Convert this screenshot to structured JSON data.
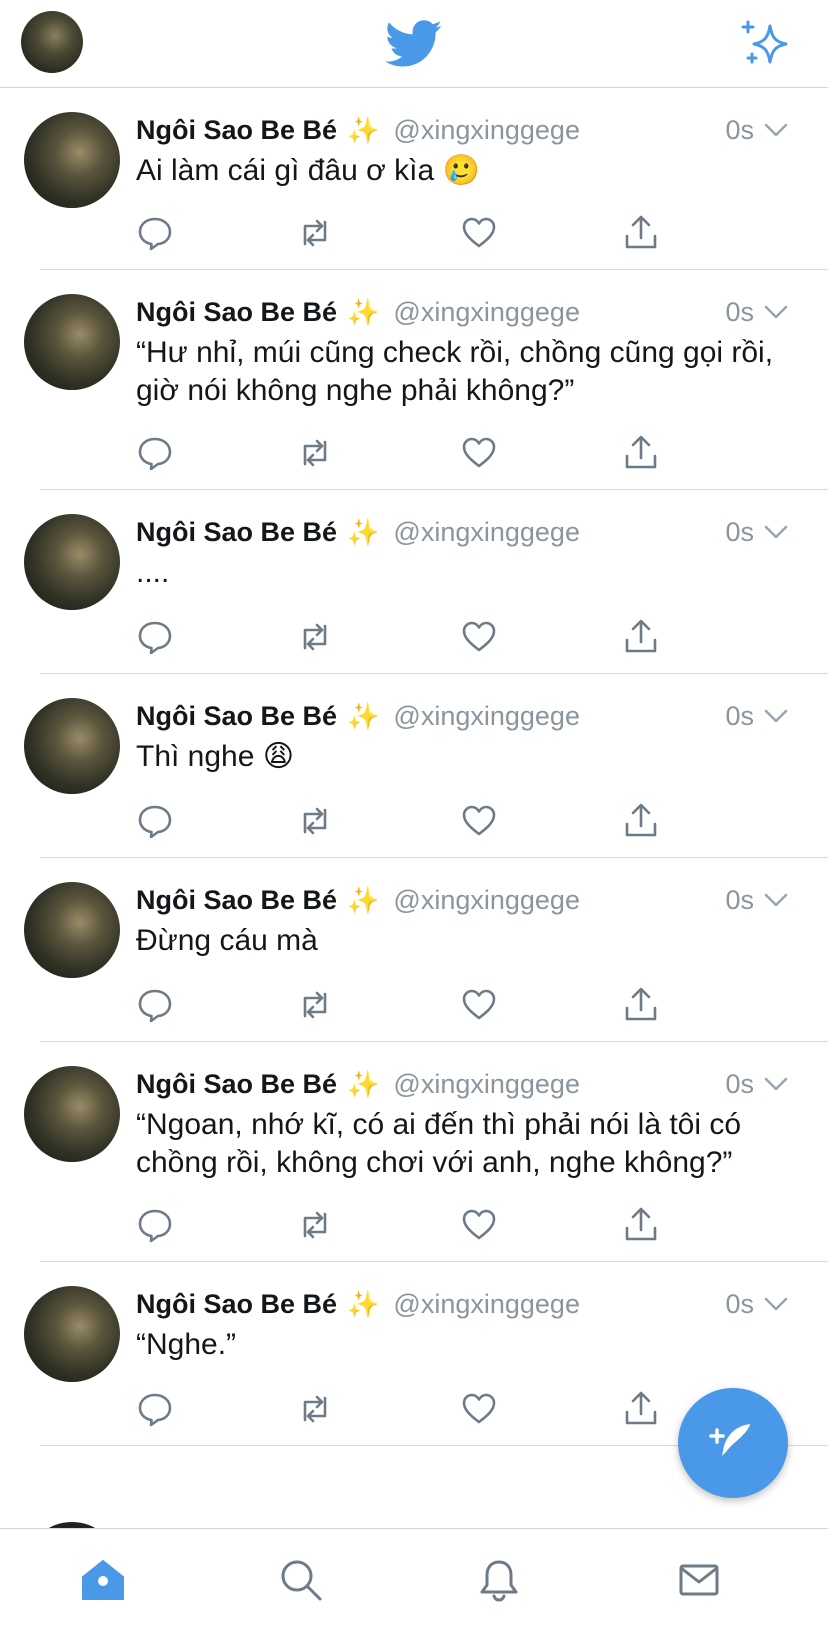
{
  "header": {
    "avatar_icon": "profile-avatar",
    "logo_icon": "twitter-bird-icon",
    "sparkle_icon": "top-tweets-sparkle-icon",
    "accent": "#4a99e9"
  },
  "tweets": [
    {
      "name": "Ngôi Sao Be Bé",
      "name_emoji": "✨",
      "handle": "@xingxinggege",
      "time": "0s",
      "text": "Ai làm cái gì đâu ơ kìa 🥲"
    },
    {
      "name": "Ngôi Sao Be Bé",
      "name_emoji": "✨",
      "handle": "@xingxinggege",
      "time": "0s",
      "text": "“Hư nhỉ, múi cũng check rồi, chồng cũng gọi rồi, giờ nói không nghe phải không?”"
    },
    {
      "name": "Ngôi Sao Be Bé",
      "name_emoji": "✨",
      "handle": "@xingxinggege",
      "time": "0s",
      "text": "...."
    },
    {
      "name": "Ngôi Sao Be Bé",
      "name_emoji": "✨",
      "handle": "@xingxinggege",
      "time": "0s",
      "text": "Thì nghe 😩"
    },
    {
      "name": "Ngôi Sao Be Bé",
      "name_emoji": "✨",
      "handle": "@xingxinggege",
      "time": "0s",
      "text": "Đừng cáu mà"
    },
    {
      "name": "Ngôi Sao Be Bé",
      "name_emoji": "✨",
      "handle": "@xingxinggege",
      "time": "0s",
      "text": "“Ngoan, nhớ kĩ, có ai đến thì phải nói là tôi có chồng rồi, không chơi với anh, nghe không?”"
    },
    {
      "name": "Ngôi Sao Be Bé",
      "name_emoji": "✨",
      "handle": "@xingxinggege",
      "time": "0s",
      "text": "“Nghe.”"
    }
  ],
  "actions": [
    "reply-icon",
    "retweet-icon",
    "like-icon",
    "share-icon"
  ],
  "fab": {
    "icon": "compose-tweet-icon"
  },
  "bottom_nav": [
    "home-icon",
    "search-icon",
    "notifications-icon",
    "messages-icon"
  ]
}
